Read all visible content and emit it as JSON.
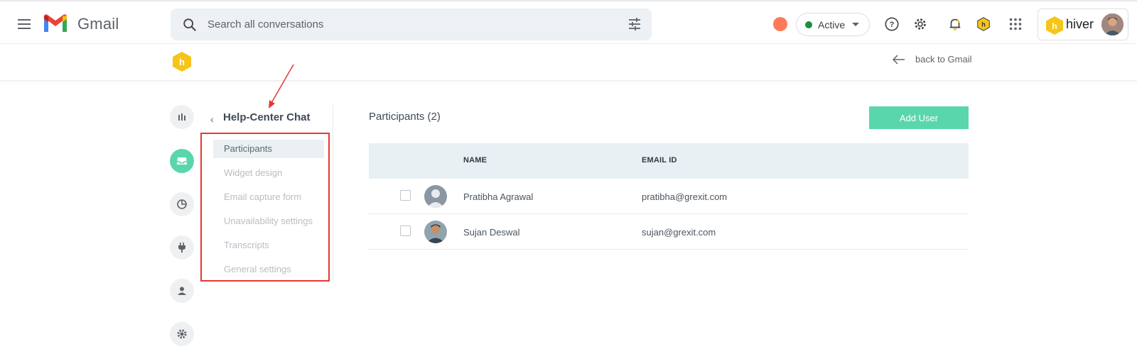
{
  "gmail_bar": {
    "app_name": "Gmail",
    "search_placeholder": "Search all conversations",
    "status_label": "Active",
    "status_color": "#1e8e3e",
    "icons": [
      "menu-icon",
      "search-icon",
      "tune-icon",
      "hubspot-icon",
      "help-icon",
      "gear-icon",
      "bell-icon",
      "hiver-hex-icon",
      "apps-grid-icon"
    ],
    "hiver_brand": "hiver"
  },
  "hiver_header": {
    "back_label": "back to Gmail"
  },
  "rail": {
    "items": [
      "analytics-icon",
      "inbox-icon",
      "reports-icon",
      "plug-icon",
      "user-icon",
      "gear-icon"
    ],
    "active_index": 1,
    "accent": "#5ad6ad"
  },
  "subnav": {
    "back_glyph": "‹",
    "title": "Help-Center Chat",
    "items": [
      {
        "label": "Participants",
        "active": true
      },
      {
        "label": "Widget design",
        "active": false
      },
      {
        "label": "Email capture form",
        "active": false
      },
      {
        "label": "Unavailability settings",
        "active": false
      },
      {
        "label": "Transcripts",
        "active": false
      },
      {
        "label": "General settings",
        "active": false
      }
    ]
  },
  "main": {
    "title": "Participants (2)",
    "add_button_label": "Add User",
    "columns": [
      "NAME",
      "EMAIL ID"
    ],
    "rows": [
      {
        "name": "Pratibha Agrawal",
        "email": "pratibha@grexit.com",
        "avatar": "default-avatar"
      },
      {
        "name": "Sujan Deswal",
        "email": "sujan@grexit.com",
        "avatar": "photo-avatar"
      }
    ]
  }
}
